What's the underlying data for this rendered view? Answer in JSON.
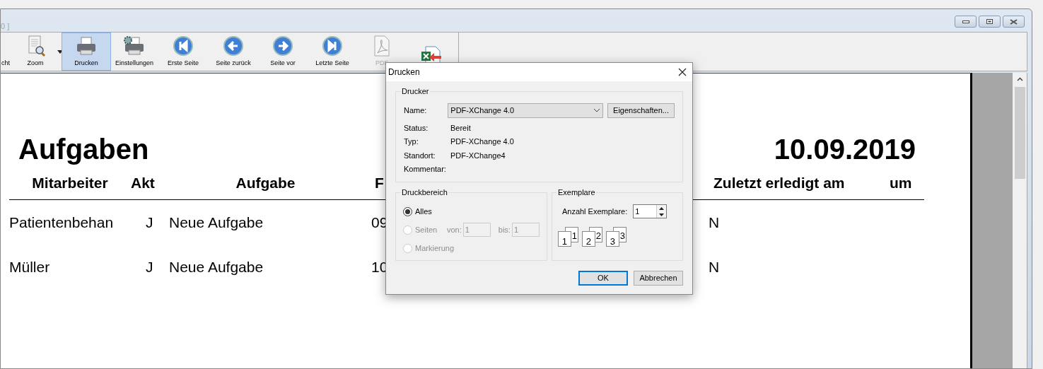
{
  "window": {
    "title": "0 ]"
  },
  "toolbar": [
    {
      "label": "cht",
      "selected": false,
      "has_menu": false
    },
    {
      "label": "Zoom",
      "selected": false,
      "has_menu": true
    },
    {
      "label": "Drucken",
      "selected": true,
      "has_menu": false
    },
    {
      "label": "Einstellungen",
      "selected": false,
      "has_menu": false
    },
    {
      "label": "Erste Seite",
      "selected": false,
      "has_menu": false
    },
    {
      "label": "Seite zurück",
      "selected": false,
      "has_menu": false
    },
    {
      "label": "Seite vor",
      "selected": false,
      "has_menu": false
    },
    {
      "label": "Letzte Seite",
      "selected": false,
      "has_menu": false
    },
    {
      "label": "PDF",
      "selected": false,
      "has_menu": false
    },
    {
      "selected": false,
      "has_menu": false
    }
  ],
  "report": {
    "title": "Aufgaben",
    "date": "10.09.2019",
    "columns": [
      "Mitarbeiter",
      "Akt",
      "Aufgabe",
      "F",
      "Zuletzt erledigt am",
      "um"
    ],
    "rows": [
      [
        "Patientenbehan",
        "J",
        "Neue Aufgabe",
        "09",
        "N"
      ],
      [
        "Müller",
        "J",
        "Neue Aufgabe",
        "10",
        "N"
      ]
    ]
  },
  "dialog": {
    "title": "Drucken",
    "printer": {
      "legend": "Drucker",
      "name_label": "Name:",
      "name_value": "PDF-XChange 4.0",
      "properties_button": "Eigenschaften...",
      "info": [
        {
          "label": "Status:",
          "value": "Bereit"
        },
        {
          "label": "Typ:",
          "value": "PDF-XChange 4.0"
        },
        {
          "label": "Standort:",
          "value": "PDF-XChange4"
        },
        {
          "label": "Kommentar:"
        }
      ]
    },
    "range": {
      "legend": "Druckbereich",
      "options": [
        {
          "label": "Alles",
          "selected": true,
          "disabled": false
        },
        {
          "label": "Seiten",
          "selected": false,
          "disabled": true
        },
        {
          "label": "Markierung",
          "selected": false,
          "disabled": true
        }
      ],
      "from_label": "von:",
      "from_value": "1",
      "to_label": "bis:",
      "to_value": "1"
    },
    "copies": {
      "legend": "Exemplare",
      "count_label": "Anzahl Exemplare:",
      "count_value": "1",
      "collate_pages": [
        {
          "back": "1",
          "front": "1"
        },
        {
          "back": "2",
          "front": "2"
        },
        {
          "back": "3",
          "front": "3"
        }
      ]
    },
    "buttons": [
      {
        "label": "OK",
        "default": true
      },
      {
        "label": "Abbrechen",
        "default": false
      }
    ]
  }
}
